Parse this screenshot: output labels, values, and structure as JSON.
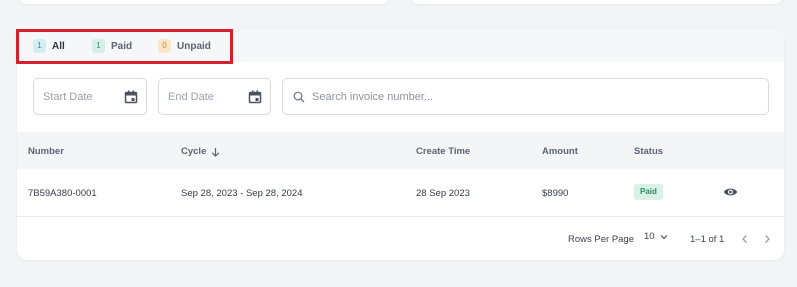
{
  "tabs": [
    {
      "count": "1",
      "label": "All"
    },
    {
      "count": "1",
      "label": "Paid"
    },
    {
      "count": "0",
      "label": "Unpaid"
    }
  ],
  "filters": {
    "start_date_placeholder": "Start Date",
    "end_date_placeholder": "End Date",
    "search_placeholder": "Search invoice number..."
  },
  "table": {
    "columns": [
      "Number",
      "Cycle",
      "Create Time",
      "Amount",
      "Status"
    ],
    "rows": [
      {
        "number": "7B59A380-0001",
        "cycle": "Sep 28, 2023 - Sep 28, 2024",
        "create_time": "28 Sep 2023",
        "amount": "$8990",
        "status": "Paid"
      }
    ]
  },
  "pagination": {
    "rows_per_page_label": "Rows Per Page",
    "rows_per_page_value": "10",
    "range": "1–1 of 1"
  },
  "colors": {
    "highlight": "#d6202b",
    "paid_badge_bg": "#d9f2e6",
    "paid_badge_text": "#2f8a5e"
  },
  "icons": {
    "date_picker": "calendar-icon",
    "search": "search-icon",
    "sort": "arrow-down-icon",
    "view": "eye-icon",
    "dropdown": "chevron-down-icon",
    "prev": "chevron-left-icon",
    "next": "chevron-right-icon"
  }
}
